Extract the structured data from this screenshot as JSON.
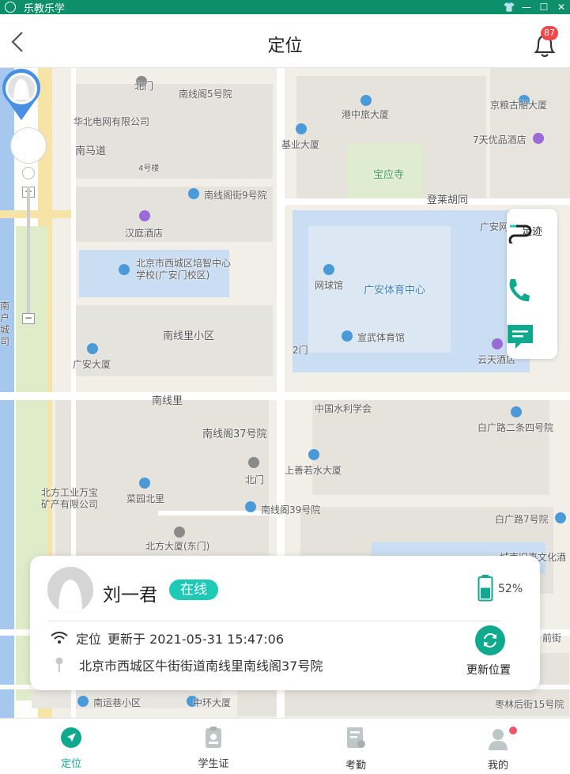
{
  "window": {
    "title": "乐教乐学"
  },
  "header": {
    "title": "定位",
    "notification_count": "87"
  },
  "map": {
    "labels": {
      "l1": "北门",
      "l2": "南线阁5号院",
      "l3": "港中旅大厦",
      "l4": "京粮古船大厦",
      "l5": "华北电网有限公司",
      "l6": "南马道",
      "l7": "基业大厦",
      "l8": "7天优品酒店",
      "l9": "宝应寺",
      "l10": "4号楼",
      "l11": "南线阁街9号院",
      "l12": "登莱胡同",
      "l13": "汉庭酒店",
      "l14": "广安网",
      "l15": "北京市西城区培智中心学校(广安门校区)",
      "l16": "网球馆",
      "l17": "广安体育中心",
      "l18": "南线里小区",
      "l19": "2门",
      "l20": "宣武体育馆",
      "l21": "广安大厦",
      "l22": "云天酒店",
      "l23": "南线里",
      "l24": "中国水利学会",
      "l25": "南线阁37号院",
      "l26": "白广路二条四号院",
      "l27": "上善若水大厦",
      "l28": "北方工业万宝矿产有限公司",
      "l29": "北门",
      "l30": "菜园北里",
      "l31": "南线阁39号院",
      "l32": "白广路7号院",
      "l33": "北方大厦(东门)",
      "l34": "城南旧事文化酒",
      "l35": "前街",
      "l36": "南运巷小区",
      "l37": "中环大厦",
      "l38": "枣林后街15号院",
      "l39": "南户城司"
    }
  },
  "side_actions": {
    "track_label": "足迹"
  },
  "card": {
    "name": "刘一君",
    "status": "在线",
    "battery_percent_text": "52%",
    "battery_level": 0.52,
    "location_prefix": "定位",
    "updated_text": "更新于 2021-05-31 15:47:06",
    "address": "北京市西城区牛街街道南线里南线阁37号院",
    "refresh_label": "更新位置"
  },
  "tabs": [
    {
      "label": "定位",
      "active": true
    },
    {
      "label": "学生证",
      "active": false
    },
    {
      "label": "考勤",
      "active": false
    },
    {
      "label": "我的",
      "active": false
    }
  ],
  "colors": {
    "accent": "#0faa8e",
    "status": "#1ec9b5",
    "titlebar": "#0e8f6c",
    "badge": "#f04848"
  }
}
